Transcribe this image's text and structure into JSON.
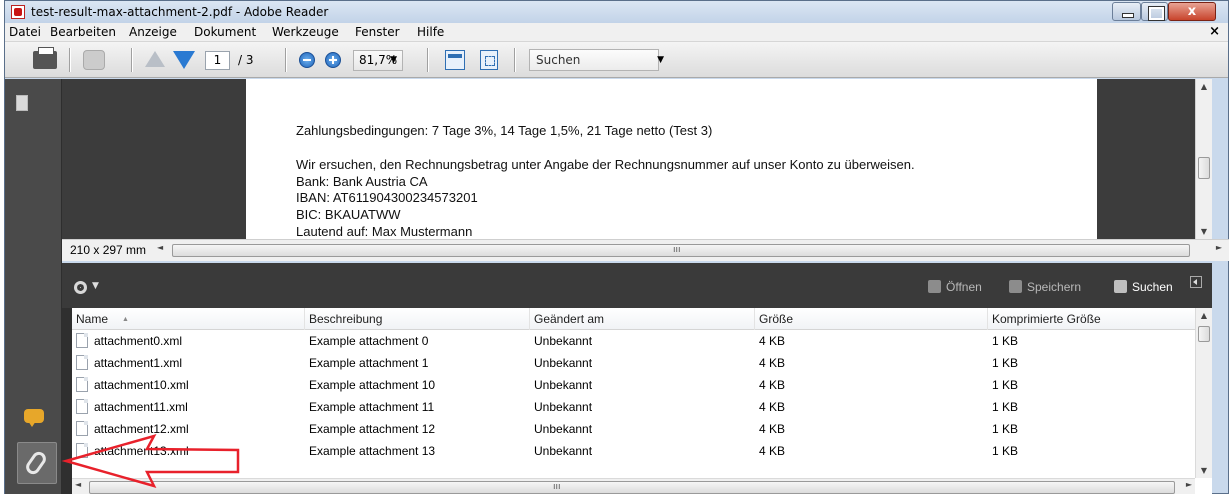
{
  "window": {
    "title": "test-result-max-attachment-2.pdf - Adobe Reader",
    "close_glyph": "x"
  },
  "menu": {
    "items": [
      "Datei",
      "Bearbeiten",
      "Anzeige",
      "Dokument",
      "Werkzeuge",
      "Fenster",
      "Hilfe"
    ],
    "close_doc": "×"
  },
  "toolbar": {
    "page_current": "1",
    "page_total": "/ 3",
    "zoom": "81,7%",
    "search_placeholder": "Suchen",
    "dropdown_glyph": "▼"
  },
  "document": {
    "lines": [
      "Zahlungsbedingungen: 7 Tage 3%, 14 Tage 1,5%, 21 Tage netto (Test 3)",
      "Wir ersuchen, den Rechnungsbetrag unter Angabe der Rechnungsnummer auf unser Konto zu überweisen.",
      "Bank: Bank Austria CA",
      "IBAN: AT611904300234573201",
      "BIC: BKAUATWW",
      "Lautend auf: Max Mustermann"
    ],
    "page_size": "210 x 297 mm"
  },
  "attachments_panel": {
    "buttons": {
      "open": "Öffnen",
      "save": "Speichern",
      "search": "Suchen"
    },
    "columns": [
      "Name",
      "Beschreibung",
      "Geändert am",
      "Größe",
      "Komprimierte Größe"
    ],
    "rows": [
      [
        "attachment0.xml",
        "Example attachment 0",
        "Unbekannt",
        "4 KB",
        "1 KB"
      ],
      [
        "attachment1.xml",
        "Example attachment 1",
        "Unbekannt",
        "4 KB",
        "1 KB"
      ],
      [
        "attachment10.xml",
        "Example attachment 10",
        "Unbekannt",
        "4 KB",
        "1 KB"
      ],
      [
        "attachment11.xml",
        "Example attachment 11",
        "Unbekannt",
        "4 KB",
        "1 KB"
      ],
      [
        "attachment12.xml",
        "Example attachment 12",
        "Unbekannt",
        "4 KB",
        "1 KB"
      ],
      [
        "attachment13.xml",
        "Example attachment 13",
        "Unbekannt",
        "4 KB",
        "1 KB"
      ]
    ]
  },
  "colors": {
    "annotation_arrow": "#e8212b",
    "nav_pane": "#4a4a4a",
    "zoom_buttons": "#1d62b8"
  }
}
